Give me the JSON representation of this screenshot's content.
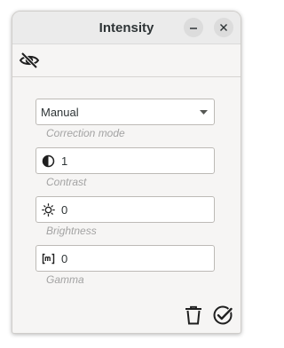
{
  "window": {
    "title": "Intensity"
  },
  "toolbar": {
    "visibility_icon": "eye-off-icon"
  },
  "correction_mode": {
    "value": "Manual",
    "caption": "Correction mode"
  },
  "contrast": {
    "value": "1",
    "caption": "Contrast",
    "icon": "contrast-icon"
  },
  "brightness": {
    "value": "0",
    "caption": "Brightness",
    "icon": "sun-icon"
  },
  "gamma": {
    "value": "0",
    "caption": "Gamma",
    "icon": "gamma-icon"
  },
  "footer": {
    "delete_icon": "trash-icon",
    "apply_icon": "check-circle-icon"
  }
}
